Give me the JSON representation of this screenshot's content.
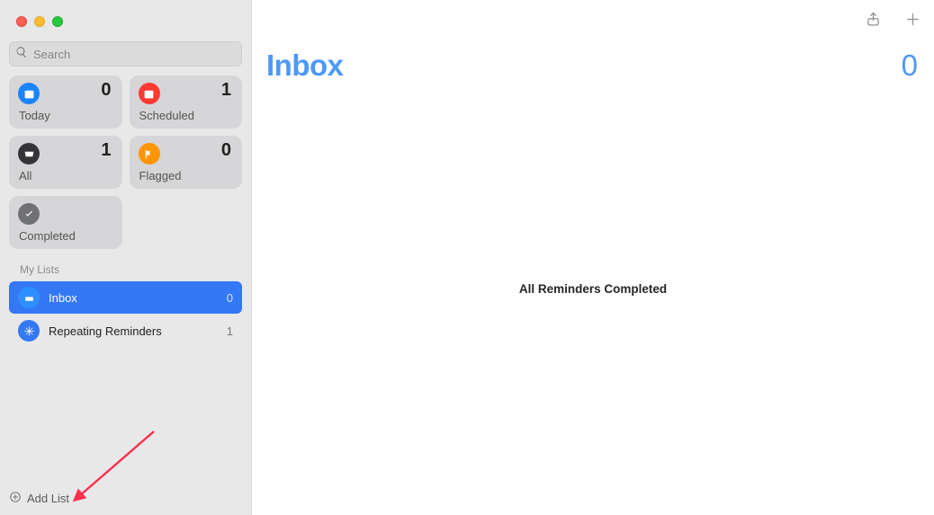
{
  "search": {
    "placeholder": "Search"
  },
  "smart": {
    "today": {
      "label": "Today",
      "count": "0"
    },
    "scheduled": {
      "label": "Scheduled",
      "count": "1"
    },
    "all": {
      "label": "All",
      "count": "1"
    },
    "flagged": {
      "label": "Flagged",
      "count": "0"
    },
    "completed": {
      "label": "Completed"
    }
  },
  "lists_header": "My Lists",
  "lists": {
    "inbox": {
      "label": "Inbox",
      "count": "0"
    },
    "repeat": {
      "label": "Repeating Reminders",
      "count": "1"
    }
  },
  "add_list_label": "Add List",
  "main": {
    "title": "Inbox",
    "count": "0",
    "empty_text": "All Reminders Completed"
  }
}
